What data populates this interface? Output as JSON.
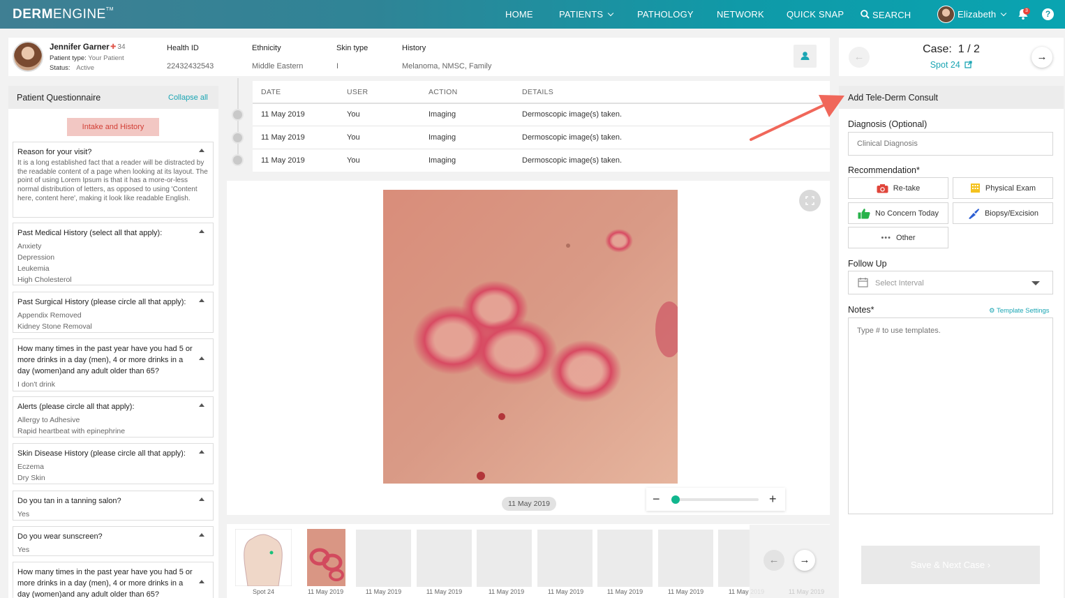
{
  "nav": {
    "logo_bold": "DERM",
    "logo_light": "ENGINE",
    "logo_tm": "TM",
    "items": [
      "HOME",
      "PATIENTS",
      "PATHOLOGY",
      "NETWORK",
      "QUICK SNAP",
      "SEARCH"
    ],
    "user_name": "Elizabeth",
    "notification_count": "3",
    "help": "?"
  },
  "patient": {
    "name": "Jennifer Garner",
    "body_count": "34",
    "type_label": "Patient type:",
    "type_value": "Your Patient",
    "status_label": "Status:",
    "status_value": "Active",
    "health_id_label": "Health ID",
    "health_id": "22432432543",
    "ethnicity_label": "Ethnicity",
    "ethnicity": "Middle Eastern",
    "skin_type_label": "Skin type",
    "skin_type": "I",
    "history_label": "History",
    "history": "Melanoma, NMSC, Family"
  },
  "case": {
    "label": "Case:",
    "counter": "1 / 2",
    "spot": "Spot 24"
  },
  "questionnaire": {
    "title": "Patient Questionnaire",
    "collapse": "Collapse all",
    "tab": "Intake and History",
    "blocks": [
      {
        "q": "Reason for your visit?",
        "a": [
          "It is a long established fact that a reader will be distracted by the readable content of a page when looking at its layout. The point of using Lorem Ipsum is that it has a more-or-less normal distribution of letters, as opposed to using 'Content here, content here', making it look like readable English."
        ]
      },
      {
        "q": "Past Medical History (select all that apply):",
        "a": [
          "Anxiety",
          "Depression",
          "Leukemia",
          "High Cholesterol"
        ]
      },
      {
        "q": "Past Surgical History (please circle all that apply):",
        "a": [
          "Appendix Removed",
          "Kidney Stone Removal"
        ]
      },
      {
        "q": "How many times in the past year have you had 5 or more drinks in a day (men), 4 or more drinks in a day (women)and any adult older than 65?",
        "a": [
          "I don't drink"
        ]
      },
      {
        "q": "Alerts (please circle all that apply):",
        "a": [
          "Allergy to Adhesive",
          "Rapid heartbeat with epinephrine"
        ]
      },
      {
        "q": "Skin Disease History (please circle all that apply):",
        "a": [
          "Eczema",
          "Dry Skin"
        ]
      },
      {
        "q": "Do you tan in a tanning salon?",
        "a": [
          "Yes"
        ]
      },
      {
        "q": "Do you wear sunscreen?",
        "a": [
          "Yes"
        ]
      },
      {
        "q": "How many times in the past year have you had 5 or more drinks in a day (men), 4 or more drinks in a day (women)and any adult older than 65?",
        "a": []
      }
    ]
  },
  "activity": {
    "headers": [
      "DATE",
      "USER",
      "ACTION",
      "DETAILS"
    ],
    "rows": [
      {
        "date": "11 May 2019",
        "user": "You",
        "action": "Imaging",
        "details": "Dermoscopic image(s) taken."
      },
      {
        "date": "11 May 2019",
        "user": "You",
        "action": "Imaging",
        "details": "Dermoscopic image(s) taken."
      },
      {
        "date": "11 May 2019",
        "user": "You",
        "action": "Imaging",
        "details": "Dermoscopic image(s) taken."
      }
    ]
  },
  "viewer": {
    "date": "11 May 2019",
    "zoom_value": 0
  },
  "thumbnails": {
    "first_label": "Spot 24",
    "dates": [
      "11 May 2019",
      "11 May 2019",
      "11 May 2019",
      "11 May 2019",
      "11 May 2019",
      "11 May 2019",
      "11 May 2019",
      "11 May 2019",
      "11 May 2019",
      "11 May 2019"
    ]
  },
  "consult": {
    "title": "Add Tele-Derm Consult",
    "diagnosis_label": "Diagnosis (Optional)",
    "diagnosis_placeholder": "Clinical Diagnosis",
    "recommendation_label": "Recommendation*",
    "recs": [
      "Re-take",
      "Physical Exam",
      "No Concern Today",
      "Biopsy/Excision",
      "Other"
    ],
    "followup_label": "Follow Up",
    "followup_placeholder": "Select Interval",
    "notes_label": "Notes*",
    "template_settings": "Template Settings",
    "notes_placeholder": "Type # to use templates.",
    "save": "Save & Next Case"
  },
  "colors": {
    "accent": "#1aa5b3",
    "tab_bg": "#f2c7c3",
    "tab_text": "#d23f36",
    "arrow": "#f0675a"
  }
}
